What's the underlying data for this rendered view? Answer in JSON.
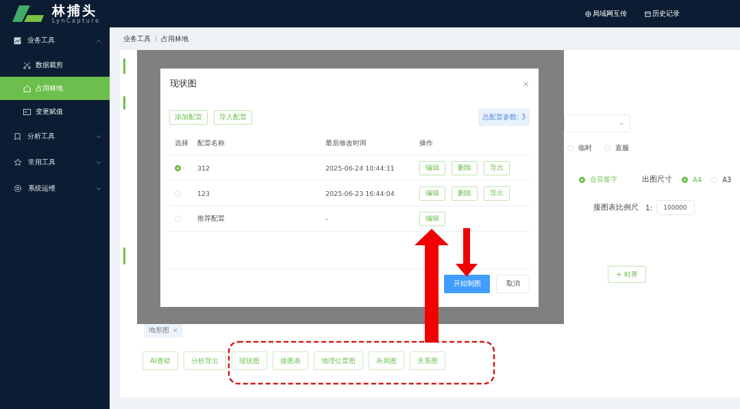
{
  "header": {
    "logo_title": "林捕头",
    "logo_subtitle": "LynCapture",
    "actions": [
      {
        "label": "局域网互传"
      },
      {
        "label": "历史记录"
      }
    ]
  },
  "sidebar": {
    "items": [
      {
        "label": "业务工具",
        "expanded": true,
        "children": [
          {
            "label": "数据裁剪",
            "selected": false
          },
          {
            "label": "占用林地",
            "selected": true
          },
          {
            "label": "变更赋值",
            "selected": false
          }
        ]
      },
      {
        "label": "分析工具",
        "expanded": false
      },
      {
        "label": "常用工具",
        "expanded": false
      },
      {
        "label": "系统运维",
        "expanded": false
      }
    ]
  },
  "breadcrumb": {
    "items": [
      "业务工具",
      "占用林地"
    ],
    "separator": "/"
  },
  "form": {
    "duty_options": [
      {
        "label": "临时",
        "selected": false
      },
      {
        "label": "直服",
        "selected": false
      }
    ],
    "page_sign": {
      "label": "合页签字",
      "selected": true
    },
    "output_size": {
      "label": "出图尺寸",
      "options": [
        {
          "label": "A4",
          "selected": true
        },
        {
          "label": "A3",
          "selected": false
        }
      ]
    },
    "scale": {
      "label": "接图表比例尺",
      "prefix": "1:",
      "value": "100000"
    },
    "add_button": {
      "icon": "+",
      "label": "时界"
    },
    "tags": [
      {
        "label": "地形图",
        "close": "×"
      }
    ],
    "actions": [
      "AI查错",
      "分析导出",
      "现状图",
      "接图表",
      "地理位置图",
      "布局图",
      "关系图"
    ]
  },
  "modal": {
    "title": "现状图",
    "close": "×",
    "toolbar": [
      "添加配置",
      "导入配置"
    ],
    "count_badge": "总配置参数: 3",
    "columns": [
      "选择",
      "配置名称",
      "最后修改时间",
      "操作"
    ],
    "rows": [
      {
        "selected": true,
        "name": "312",
        "modified": "2025-06-24 10:44:11",
        "actions": [
          "编辑",
          "删除",
          "导出"
        ]
      },
      {
        "selected": false,
        "name": "123",
        "modified": "2025-06-23 16:44:04",
        "actions": [
          "编辑",
          "删除",
          "导出"
        ]
      },
      {
        "selected": false,
        "name": "推荐配置",
        "modified": "-",
        "actions": [
          "编辑"
        ]
      }
    ],
    "primary_button": "开始制图",
    "cancel_button": "取消"
  }
}
